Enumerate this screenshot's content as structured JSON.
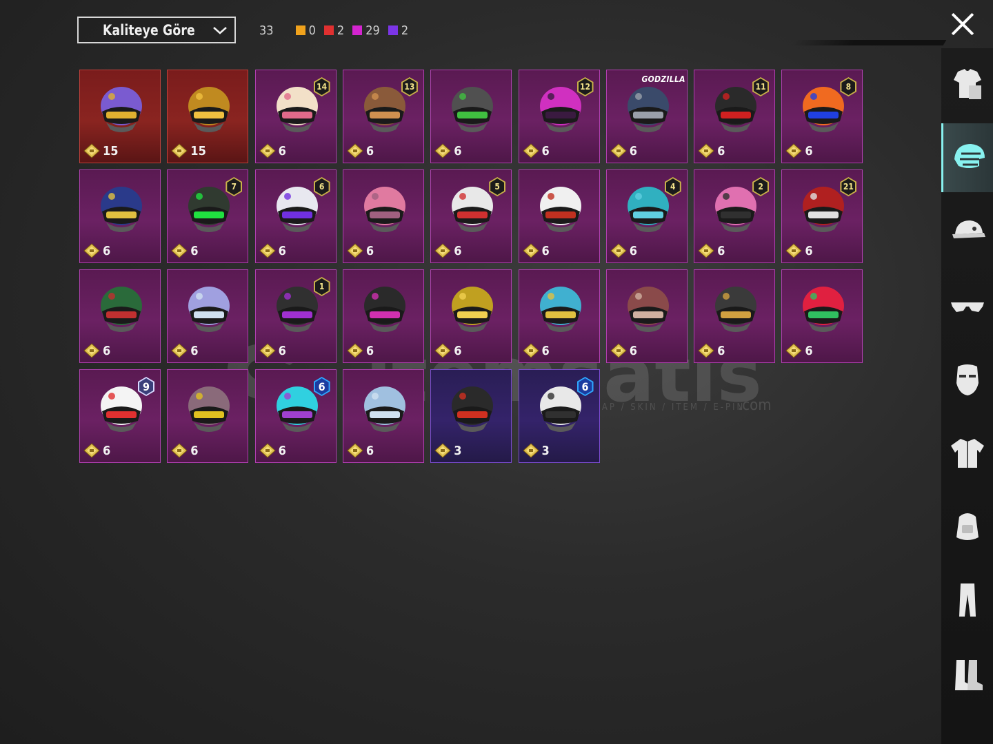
{
  "filter": {
    "sort_label": "Kaliteye Göre",
    "total": "33"
  },
  "rarity_counts": [
    {
      "color": "#f0a21c",
      "count": "0"
    },
    {
      "color": "#e03030",
      "count": "2"
    },
    {
      "color": "#d424d0",
      "count": "29"
    },
    {
      "color": "#7b35e6",
      "count": "2"
    }
  ],
  "items": [
    {
      "cost": "15",
      "rarity": "red",
      "badge": "",
      "helmet": [
        "#7a5bd0",
        "#e0b030"
      ]
    },
    {
      "cost": "15",
      "rarity": "red",
      "badge": "",
      "helmet": [
        "#c08a20",
        "#f0c040"
      ]
    },
    {
      "cost": "6",
      "rarity": "purple",
      "badge": "14",
      "helmet": [
        "#f2e0c8",
        "#e06a8a"
      ]
    },
    {
      "cost": "6",
      "rarity": "purple",
      "badge": "13",
      "helmet": [
        "#8a5a3a",
        "#d09050"
      ]
    },
    {
      "cost": "6",
      "rarity": "purple",
      "badge": "",
      "helmet": [
        "#505050",
        "#40c040"
      ]
    },
    {
      "cost": "6",
      "rarity": "purple",
      "badge": "12",
      "helmet": [
        "#d030c0",
        "#3a1a40"
      ]
    },
    {
      "cost": "6",
      "rarity": "purple",
      "badge": "",
      "label": "GODZILLA",
      "helmet": [
        "#3a4a6a",
        "#9aa0aa"
      ]
    },
    {
      "cost": "6",
      "rarity": "purple",
      "badge": "11",
      "helmet": [
        "#2a2a2a",
        "#d02020"
      ]
    },
    {
      "cost": "6",
      "rarity": "purple",
      "badge": "8",
      "helmet": [
        "#f06a20",
        "#2040e0"
      ]
    },
    {
      "cost": "6",
      "rarity": "purple",
      "badge": "",
      "helmet": [
        "#2a3a8a",
        "#e0c040"
      ]
    },
    {
      "cost": "6",
      "rarity": "purple",
      "badge": "7",
      "helmet": [
        "#303a30",
        "#20e040"
      ]
    },
    {
      "cost": "6",
      "rarity": "purple",
      "badge": "6",
      "helmet": [
        "#e8e8f0",
        "#7030e0"
      ]
    },
    {
      "cost": "6",
      "rarity": "purple",
      "badge": "",
      "helmet": [
        "#e07aa0",
        "#a06080"
      ]
    },
    {
      "cost": "6",
      "rarity": "purple",
      "badge": "5",
      "helmet": [
        "#e8e8e8",
        "#d03030"
      ]
    },
    {
      "cost": "6",
      "rarity": "purple",
      "badge": "",
      "helmet": [
        "#f0f0f0",
        "#c03020"
      ]
    },
    {
      "cost": "6",
      "rarity": "purple",
      "badge": "4",
      "helmet": [
        "#30b0c0",
        "#60d0e0"
      ]
    },
    {
      "cost": "6",
      "rarity": "purple",
      "badge": "2",
      "helmet": [
        "#e070b0",
        "#303030"
      ]
    },
    {
      "cost": "6",
      "rarity": "purple",
      "badge": "21",
      "helmet": [
        "#b02020",
        "#e0e0e0"
      ]
    },
    {
      "cost": "6",
      "rarity": "purple",
      "badge": "",
      "helmet": [
        "#2a6a3a",
        "#c03030"
      ]
    },
    {
      "cost": "6",
      "rarity": "purple",
      "badge": "",
      "helmet": [
        "#a0a0e0",
        "#d0e0f0"
      ]
    },
    {
      "cost": "6",
      "rarity": "purple",
      "badge": "1",
      "helmet": [
        "#303030",
        "#a030d0"
      ]
    },
    {
      "cost": "6",
      "rarity": "purple",
      "badge": "",
      "helmet": [
        "#2a2a2a",
        "#d030b0"
      ]
    },
    {
      "cost": "6",
      "rarity": "purple",
      "badge": "",
      "helmet": [
        "#c0a020",
        "#f0d050"
      ]
    },
    {
      "cost": "6",
      "rarity": "purple",
      "badge": "",
      "helmet": [
        "#40b0d0",
        "#e0c040"
      ]
    },
    {
      "cost": "6",
      "rarity": "purple",
      "badge": "",
      "helmet": [
        "#8a4a4a",
        "#d0b0a0"
      ]
    },
    {
      "cost": "6",
      "rarity": "purple",
      "badge": "",
      "helmet": [
        "#3a3a3a",
        "#d0a040"
      ]
    },
    {
      "cost": "6",
      "rarity": "purple",
      "badge": "",
      "helmet": [
        "#e02040",
        "#30c060"
      ]
    },
    {
      "cost": "6",
      "rarity": "purple",
      "badge": "9",
      "helmet": [
        "#f4f4f4",
        "#e03030"
      ]
    },
    {
      "cost": "6",
      "rarity": "purple",
      "badge": "",
      "helmet": [
        "#8a6a7a",
        "#e0c020"
      ]
    },
    {
      "cost": "6",
      "rarity": "purple",
      "badge": "6",
      "helmet": [
        "#30d0e0",
        "#a040d0"
      ]
    },
    {
      "cost": "6",
      "rarity": "purple",
      "badge": "",
      "helmet": [
        "#a0c0e0",
        "#d0e0f0"
      ]
    },
    {
      "cost": "3",
      "rarity": "blue",
      "badge": "",
      "helmet": [
        "#2a2a2a",
        "#d03020"
      ]
    },
    {
      "cost": "3",
      "rarity": "blue",
      "badge": "6",
      "helmet": [
        "#e8e8e8",
        "#303030"
      ]
    }
  ],
  "sidebar": [
    {
      "icon": "outfit-icon",
      "active": false
    },
    {
      "icon": "helmet-icon",
      "active": true
    },
    {
      "icon": "cap-icon",
      "active": false
    },
    {
      "icon": "glasses-icon",
      "active": false
    },
    {
      "icon": "mask-icon",
      "active": false
    },
    {
      "icon": "jacket-icon",
      "active": false
    },
    {
      "icon": "backpack-icon",
      "active": false
    },
    {
      "icon": "pants-icon",
      "active": false
    },
    {
      "icon": "boots-icon",
      "active": false
    }
  ],
  "watermark": {
    "brand": "itemsatis",
    "tagline": "HESAP / SKIN / ITEM / E-PIN",
    "domain": ".com"
  },
  "colors": {
    "active_accent": "#88f2f0",
    "card_border": "#b03fb0"
  }
}
